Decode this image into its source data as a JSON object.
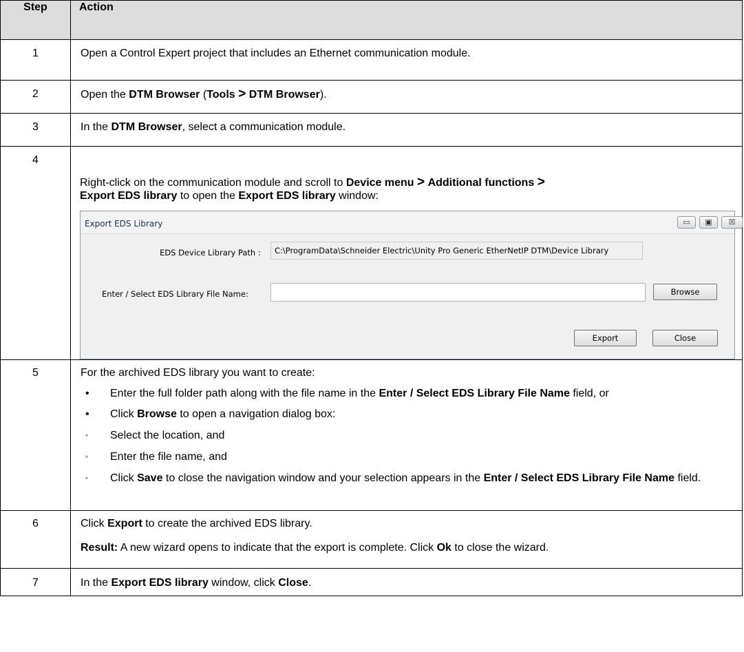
{
  "table": {
    "headers": {
      "step": "Step",
      "action": "Action"
    },
    "rows": {
      "r1": {
        "num": "1",
        "text": "Open a Control Expert project that includes an Ethernet communication module."
      },
      "r2": {
        "num": "2",
        "t1": "Open the ",
        "b1": "DTM Browser",
        "t2": " (",
        "b2": "Tools",
        "sep": ">",
        "b3": "DTM Browser",
        "t3": ")."
      },
      "r3": {
        "num": "3",
        "t1": "In the ",
        "b1": "DTM Browser",
        "t2": ", select a communication module."
      },
      "r4": {
        "num": "4",
        "t1": "Right-click on the communication module and scroll to ",
        "b1": "Device menu",
        "sep": ">",
        "b2": "Additional functions",
        "b3": "Export EDS library",
        "t2": " to open the ",
        "b4": "Export EDS library",
        "t3": " window:"
      },
      "r5": {
        "num": "5",
        "intro": "For the archived EDS library you want to create:",
        "bullet_glyph": "•",
        "sub_glyph": "◦",
        "b1_t1": "Enter the full folder path along with the file name in the ",
        "b1_b": "Enter / Select EDS Library File Name",
        "b1_t2": " field, or",
        "b2_t1": "Click ",
        "b2_b": "Browse",
        "b2_t2": " to open a navigation dialog box:",
        "s1": "Select the location, and",
        "s2": "Enter the file name, and",
        "s3_t1": "Click ",
        "s3_b1": "Save",
        "s3_t2": " to close the navigation window and your selection appears in the ",
        "s3_b2": "Enter / Select EDS Library File Name",
        "s3_t3": " field."
      },
      "r6": {
        "num": "6",
        "t1": "Click ",
        "b1": "Export",
        "t2": " to create the archived EDS library.",
        "rb": "Result:",
        "rt1": " A new wizard opens to indicate that the export is complete. Click ",
        "rb2": "Ok",
        "rt2": " to close the wizard."
      },
      "r7": {
        "num": "7",
        "t1": "In the ",
        "b1": "Export EDS library",
        "t2": " window, click ",
        "b2": "Close",
        "t3": "."
      }
    }
  },
  "dialog": {
    "title": "Export EDS Library",
    "min_glyph": "▭",
    "max_glyph": "▣",
    "close_glyph": "☒",
    "path_label": "EDS Device Library Path :",
    "path_value": "C:\\ProgramData\\Schneider Electric\\Unity Pro Generic EtherNetIP DTM\\Device Library",
    "file_label": "Enter / Select EDS Library File Name:",
    "file_value": "",
    "browse": "Browse",
    "export": "Export",
    "close": "Close"
  }
}
